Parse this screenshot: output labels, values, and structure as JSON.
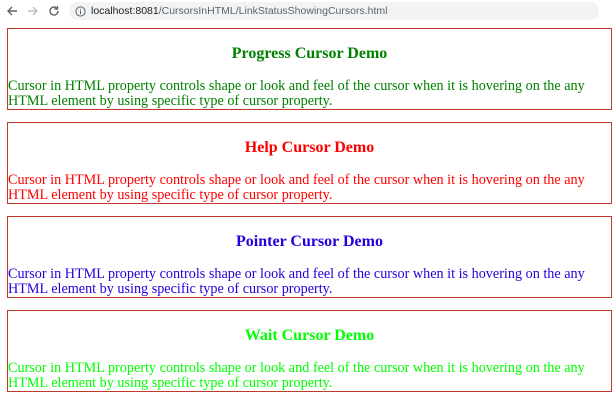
{
  "browser": {
    "url_host": "localhost:8081",
    "url_path": "/CursorsInHTML/LinkStatusShowingCursors.html",
    "back_icon": "back-arrow-icon",
    "forward_icon": "forward-arrow-icon",
    "reload_icon": "reload-icon",
    "info_icon": "info-icon"
  },
  "demos": [
    {
      "title": "Progress Cursor Demo",
      "text": "Cursor in HTML property controls shape or look and feel of the cursor when it is hovering on the any HTML element by using specific type of cursor property.",
      "color": "#008000"
    },
    {
      "title": "Help Cursor Demo",
      "text": "Cursor in HTML property controls shape or look and feel of the cursor when it is hovering on the any HTML element by using specific type of cursor property.",
      "color": "#ff0000"
    },
    {
      "title": "Pointer Cursor Demo",
      "text": "Cursor in HTML property controls shape or look and feel of the cursor when it is hovering on the any HTML element by using specific type of cursor property.",
      "color": "#2200dd"
    },
    {
      "title": "Wait Cursor Demo",
      "text": "Cursor in HTML property controls shape or look and feel of the cursor when it is hovering on the any HTML element by using specific type of cursor property.",
      "color": "#00ff00"
    }
  ]
}
